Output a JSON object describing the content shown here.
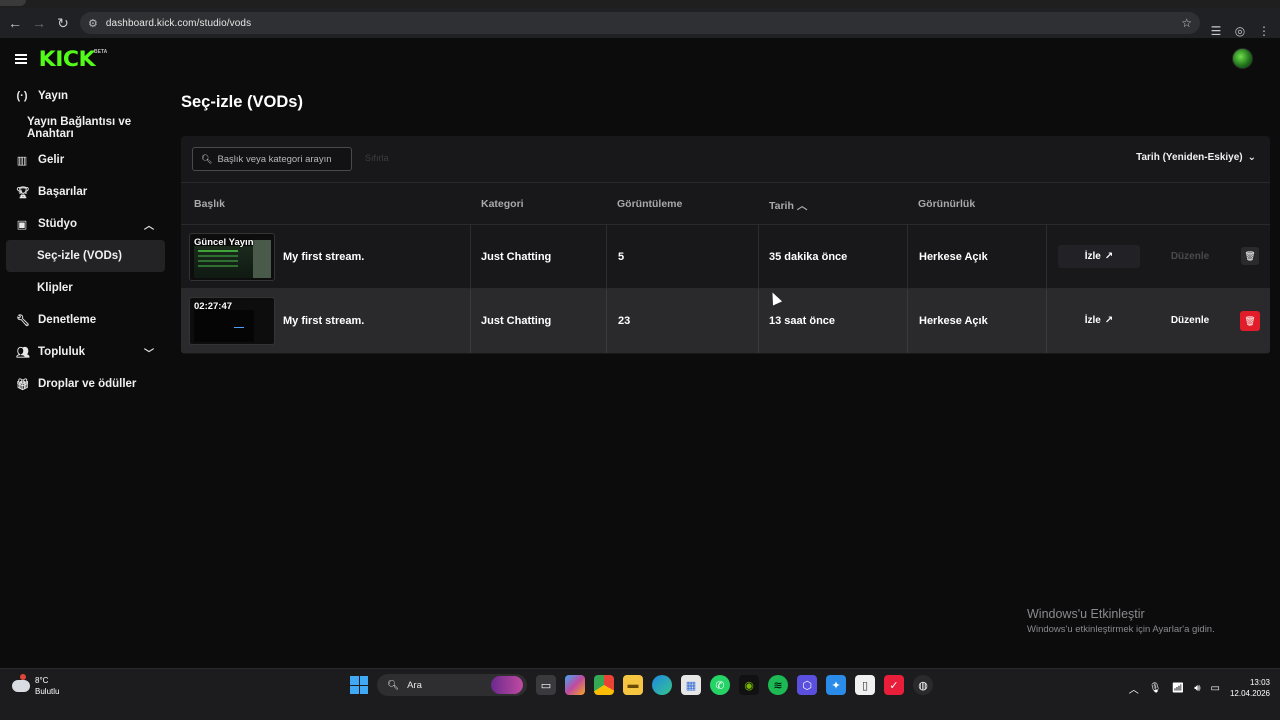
{
  "browser": {
    "url": "dashboard.kick.com/studio/vods"
  },
  "app": {
    "logo": "KICK",
    "logo_badge": "BETA"
  },
  "sidebar": {
    "items": [
      {
        "label": "Yayın"
      },
      {
        "label": "Yayın Bağlantısı ve Anahtarı"
      },
      {
        "label": "Gelir"
      },
      {
        "label": "Başarılar"
      },
      {
        "label": "Stüdyo"
      },
      {
        "label": "Seç-izle (VODs)"
      },
      {
        "label": "Klipler"
      },
      {
        "label": "Denetleme"
      },
      {
        "label": "Topluluk"
      },
      {
        "label": "Droplar ve ödüller"
      }
    ]
  },
  "page": {
    "title": "Seç-izle (VODs)"
  },
  "toolbar": {
    "search_placeholder": "Başlık veya kategori arayın",
    "reset_label": "Sıfırla",
    "sort_label": "Tarih (Yeniden-Eskiye)"
  },
  "table": {
    "columns": [
      "Başlık",
      "Kategori",
      "Görüntüleme",
      "Tarih",
      "Görünürlük"
    ],
    "rows": [
      {
        "badge": "Güncel Yayın",
        "title": "My first stream.",
        "category": "Just Chatting",
        "views": "5",
        "date": "35 dakika önce",
        "visibility": "Herkese Açık",
        "watch": "İzle",
        "edit": "Düzenle"
      },
      {
        "badge": "02:27:47",
        "title": "My first stream.",
        "category": "Just Chatting",
        "views": "23",
        "date": "13 saat önce",
        "visibility": "Herkese Açık",
        "watch": "İzle",
        "edit": "Düzenle"
      }
    ]
  },
  "watermark": {
    "title": "Windows'u Etkinleştir",
    "subtitle": "Windows'u etkinleştirmek için Ayarlar'a gidin."
  },
  "taskbar": {
    "weather_temp": "8°C",
    "weather_desc": "Bulutlu",
    "search_label": "Ara",
    "time": "13:03",
    "date": "12.04.2026"
  },
  "colors": {
    "brand": "#53fc18",
    "danger": "#e11d2a"
  }
}
